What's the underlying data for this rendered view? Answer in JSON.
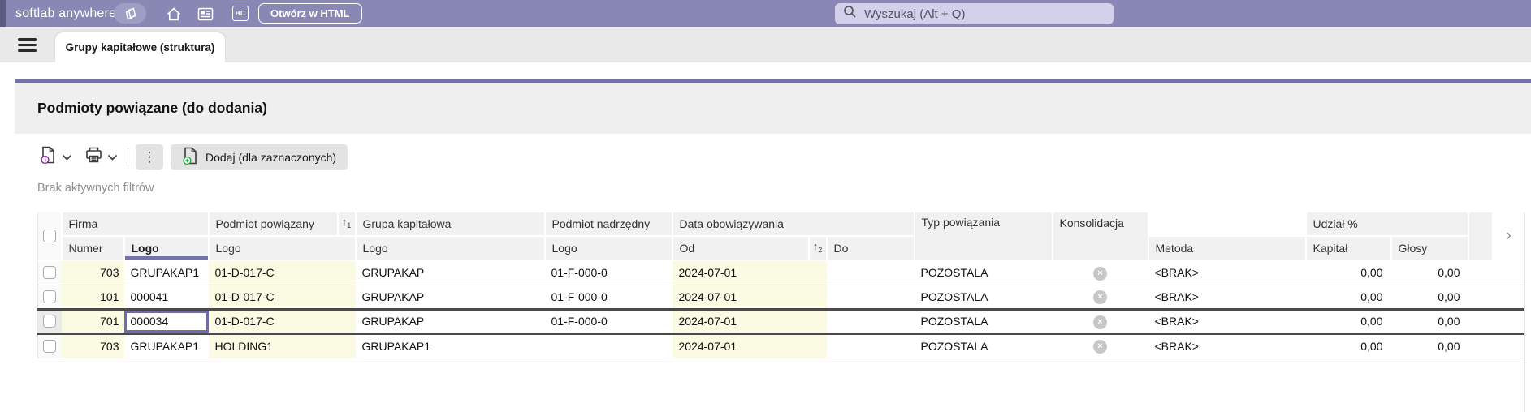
{
  "topbar": {
    "brand": "softlab anywhere",
    "open_in_html_button": "Otwórz w HTML",
    "bc_icon_label": "BC",
    "search": {
      "placeholder": "Wyszukaj (Alt + Q)"
    },
    "colors": {
      "bar_bg": "#8987B4",
      "search_bg": "#D2D0EA",
      "accent": "#7472AE"
    }
  },
  "tabbar": {
    "active_tab": "Grupy kapitałowe (struktura)"
  },
  "panel": {
    "title": "Podmioty powiązane (do dodania)",
    "toolbar": {
      "add_button_label": "Dodaj (dla zaznaczonych)"
    },
    "filters_status": "Brak aktywnych filtrów"
  },
  "table": {
    "group_headers": {
      "firma": "Firma",
      "podmiot_powiazany": "Podmiot powiązany",
      "grupa_kapitalowa": "Grupa kapitałowa",
      "podmiot_nadrzedny": "Podmiot nadrzędny",
      "data_obowiazywania": "Data obowiązywania",
      "typ_powiazania": "Typ powiązania",
      "konsolidacja": "Konsolidacja",
      "udzial_procent": "Udział %"
    },
    "sub_headers": {
      "numer": "Numer",
      "logo": "Logo",
      "od": "Od",
      "do": "Do",
      "metoda": "Metoda",
      "kapital": "Kapitał",
      "glosy": "Głosy"
    },
    "sort": {
      "podmiot_powiazany_rank": "1",
      "od_rank": "2"
    },
    "rows": [
      {
        "numer": "703",
        "firma_logo": "GRUPAKAP1",
        "podmiot_powiazany_logo": "01-D-017-C",
        "grupa_kapitalowa_logo": "GRUPAKAP",
        "podmiot_nadrzedny_logo": "01-F-000-0",
        "od": "2024-07-01",
        "do": "",
        "typ_powiazania": "POZOSTALA",
        "metoda": "<BRAK>",
        "kapital": "0,00",
        "glosy": "0,00"
      },
      {
        "numer": "101",
        "firma_logo": "000041",
        "podmiot_powiazany_logo": "01-D-017-C",
        "grupa_kapitalowa_logo": "GRUPAKAP",
        "podmiot_nadrzedny_logo": "01-F-000-0",
        "od": "2024-07-01",
        "do": "",
        "typ_powiazania": "POZOSTALA",
        "metoda": "<BRAK>",
        "kapital": "0,00",
        "glosy": "0,00"
      },
      {
        "numer": "701",
        "firma_logo": "000034",
        "podmiot_powiazany_logo": "01-D-017-C",
        "grupa_kapitalowa_logo": "GRUPAKAP",
        "podmiot_nadrzedny_logo": "01-F-000-0",
        "od": "2024-07-01",
        "do": "",
        "typ_powiazania": "POZOSTALA",
        "metoda": "<BRAK>",
        "kapital": "0,00",
        "glosy": "0,00",
        "selected": true
      },
      {
        "numer": "703",
        "firma_logo": "GRUPAKAP1",
        "podmiot_powiazany_logo": "HOLDING1",
        "grupa_kapitalowa_logo": "GRUPAKAP1",
        "podmiot_nadrzedny_logo": "",
        "od": "2024-07-01",
        "do": "",
        "typ_powiazania": "POZOSTALA",
        "metoda": "<BRAK>",
        "kapital": "0,00",
        "glosy": "0,00"
      }
    ]
  },
  "icons": {
    "sort_asc": "↑",
    "consolidation_off": "×",
    "kebab_menu": "⋮",
    "scroll_right_chevron": "›"
  }
}
